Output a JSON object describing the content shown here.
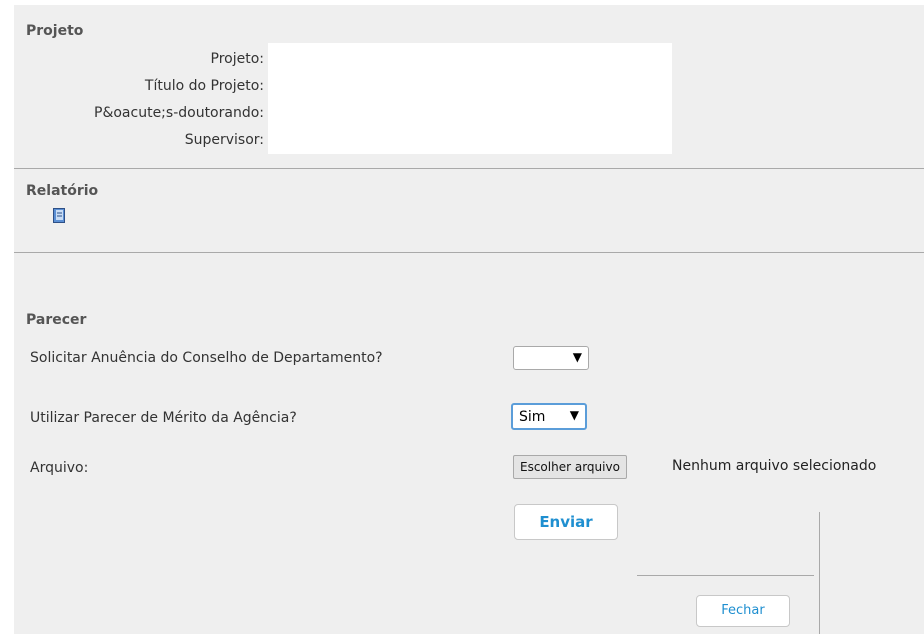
{
  "projeto": {
    "title": "Projeto",
    "fields": [
      {
        "label": "Projeto:"
      },
      {
        "label": "Título do Projeto:"
      },
      {
        "label": "P&oacute;s-doutorando:"
      },
      {
        "label": "Supervisor:"
      }
    ]
  },
  "relatorio": {
    "title": "Relatório",
    "icon": "document-icon"
  },
  "parecer": {
    "title": "Parecer",
    "q1": {
      "label": "Solicitar Anuência do Conselho de Departamento?",
      "value": ""
    },
    "q2": {
      "label": "Utilizar Parecer de Mérito da Agência?",
      "value": "Sim"
    },
    "arquivo": {
      "label": "Arquivo:",
      "button": "Escolher arquivo",
      "status": "Nenhum arquivo selecionado"
    },
    "submit": "Enviar"
  },
  "footer": {
    "close": "Fechar"
  },
  "colors": {
    "accent": "#1f8fd0",
    "panel": "#efefef",
    "divider": "#a9a9a9"
  }
}
